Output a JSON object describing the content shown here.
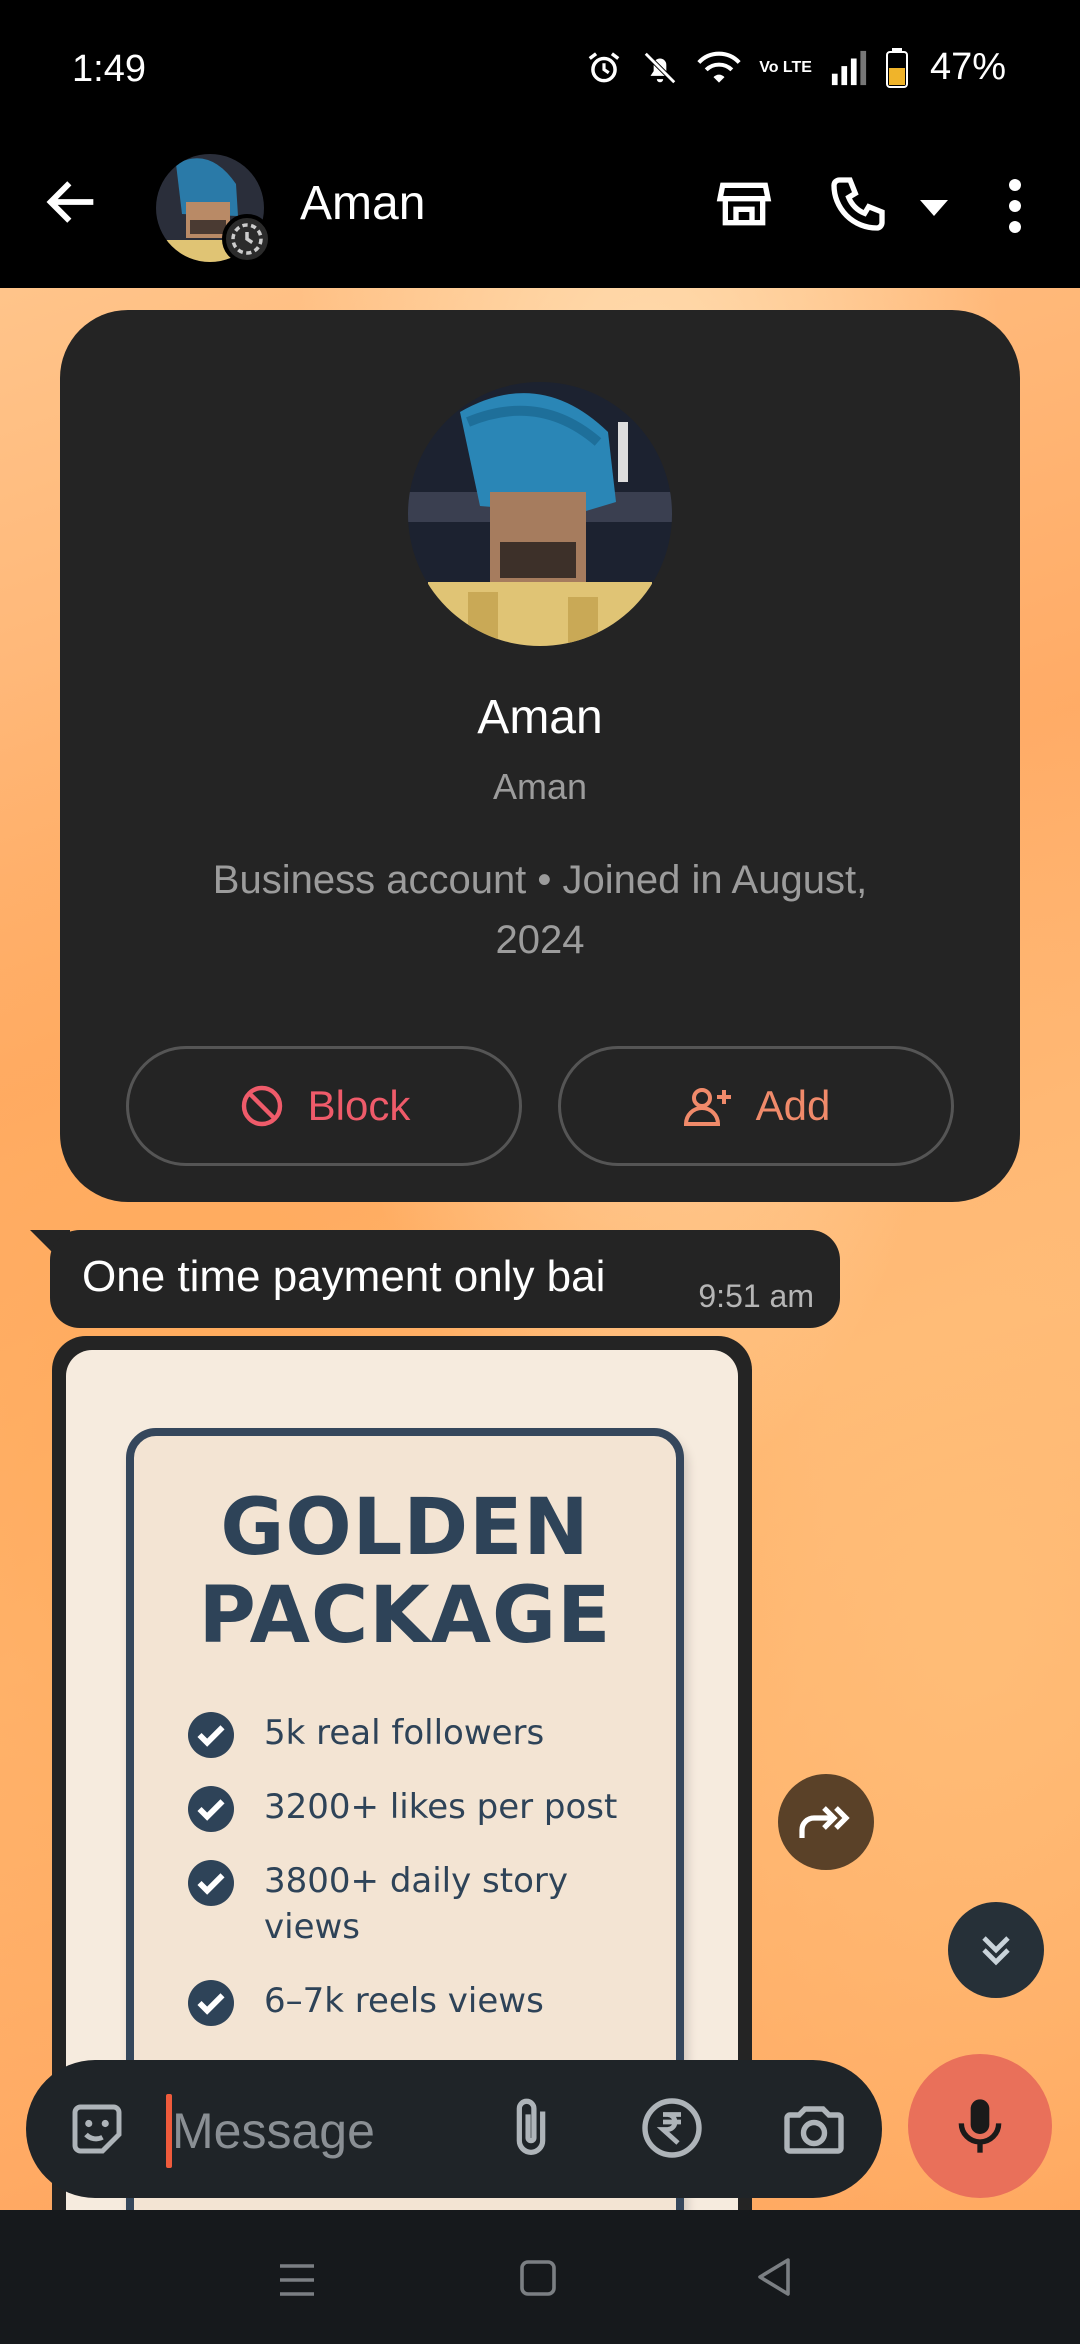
{
  "status_bar": {
    "time": "1:49",
    "network": "Vo LTE",
    "battery": "47%"
  },
  "header": {
    "contact_name": "Aman",
    "icons": [
      "back-arrow-icon",
      "store-icon",
      "phone-icon",
      "chevron-down-icon",
      "more-vert-icon"
    ]
  },
  "profile_card": {
    "name": "Aman",
    "username": "Aman",
    "meta": "Business account • Joined in August, 2024",
    "block_label": "Block",
    "add_label": "Add"
  },
  "messages": [
    {
      "text": "One time payment only bai",
      "time": "9:51 am"
    }
  ],
  "image_message": {
    "title": "GOLDEN PACKAGE",
    "items": [
      "5k real followers",
      "3200+ likes per post",
      "3800+ daily story views",
      "6–7k reels views"
    ]
  },
  "composer": {
    "placeholder": "Message"
  },
  "colors": {
    "accent_red": "#ef5b6a",
    "mic_button": "#e9705a",
    "card_bg": "#242424",
    "package_text": "#2e4358"
  }
}
